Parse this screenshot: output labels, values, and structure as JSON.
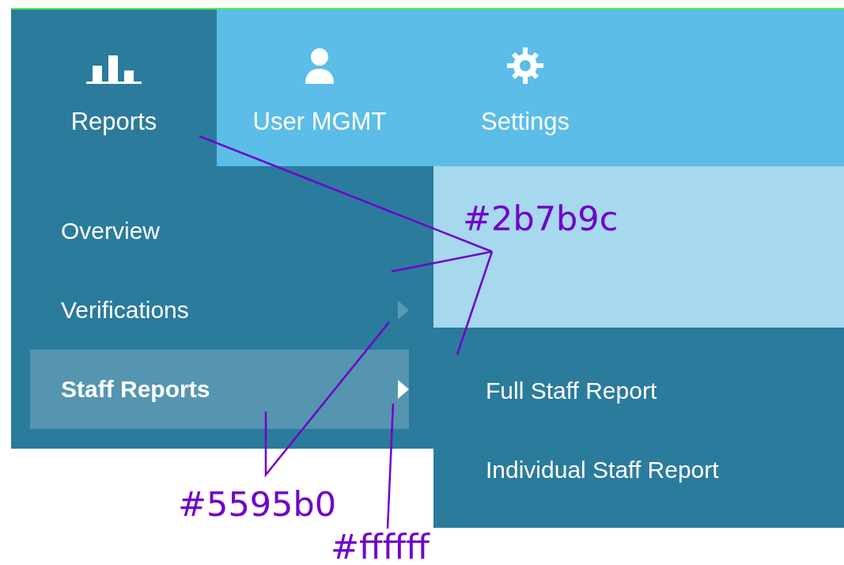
{
  "tabs": [
    {
      "label": "Reports",
      "kind": "chart",
      "selected": true
    },
    {
      "label": "User MGMT",
      "kind": "user",
      "selected": false
    },
    {
      "label": "Settings",
      "kind": "gear",
      "selected": false
    }
  ],
  "menu": {
    "items": [
      {
        "label": "Overview",
        "has_submenu": false,
        "selected": false
      },
      {
        "label": "Verifications",
        "has_submenu": true,
        "selected": false
      },
      {
        "label": "Staff Reports",
        "has_submenu": true,
        "selected": true
      }
    ]
  },
  "submenu": {
    "items": [
      {
        "label": "Full Staff Report"
      },
      {
        "label": "Individual Staff Report"
      }
    ]
  },
  "annotations": [
    {
      "text": "#2b7b9c"
    },
    {
      "text": "#5595b0"
    },
    {
      "text": "#ffffff"
    }
  ]
}
